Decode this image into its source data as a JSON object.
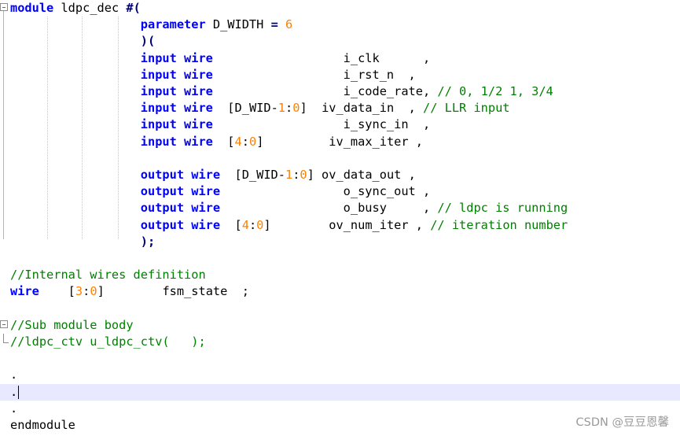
{
  "editor": {
    "lines": [
      [
        [
          "kw",
          "module"
        ],
        [
          "id",
          " ldpc_dec "
        ],
        [
          "op",
          "#("
        ]
      ],
      [
        [
          "id",
          "                  "
        ],
        [
          "kw",
          "parameter"
        ],
        [
          "id",
          " D_WIDTH "
        ],
        [
          "op",
          "="
        ],
        [
          "id",
          " "
        ],
        [
          "num",
          "6"
        ]
      ],
      [
        [
          "id",
          "                  "
        ],
        [
          "op",
          ")("
        ]
      ],
      [
        [
          "id",
          "                  "
        ],
        [
          "kw",
          "input wire"
        ],
        [
          "id",
          "                  i_clk      ,"
        ]
      ],
      [
        [
          "id",
          "                  "
        ],
        [
          "kw",
          "input wire"
        ],
        [
          "id",
          "                  i_rst_n  ,"
        ]
      ],
      [
        [
          "id",
          "                  "
        ],
        [
          "kw",
          "input wire"
        ],
        [
          "id",
          "                  i_code_rate, "
        ],
        [
          "cm",
          "// 0, 1/2 1, 3/4"
        ]
      ],
      [
        [
          "id",
          "                  "
        ],
        [
          "kw",
          "input wire"
        ],
        [
          "id",
          "  [D_WID-"
        ],
        [
          "num",
          "1"
        ],
        [
          "id",
          ":"
        ],
        [
          "num",
          "0"
        ],
        [
          "id",
          "]  iv_data_in  , "
        ],
        [
          "cm",
          "// LLR input"
        ]
      ],
      [
        [
          "id",
          "                  "
        ],
        [
          "kw",
          "input wire"
        ],
        [
          "id",
          "                  i_sync_in  ,"
        ]
      ],
      [
        [
          "id",
          "                  "
        ],
        [
          "kw",
          "input wire"
        ],
        [
          "id",
          "  ["
        ],
        [
          "num",
          "4"
        ],
        [
          "id",
          ":"
        ],
        [
          "num",
          "0"
        ],
        [
          "id",
          "]         iv_max_iter ,"
        ]
      ],
      [],
      [
        [
          "id",
          "                  "
        ],
        [
          "kw",
          "output wire"
        ],
        [
          "id",
          "  [D_WID-"
        ],
        [
          "num",
          "1"
        ],
        [
          "id",
          ":"
        ],
        [
          "num",
          "0"
        ],
        [
          "id",
          "] ov_data_out ,"
        ]
      ],
      [
        [
          "id",
          "                  "
        ],
        [
          "kw",
          "output wire"
        ],
        [
          "id",
          "                 o_sync_out ,"
        ]
      ],
      [
        [
          "id",
          "                  "
        ],
        [
          "kw",
          "output wire"
        ],
        [
          "id",
          "                 o_busy     , "
        ],
        [
          "cm",
          "// ldpc is running"
        ]
      ],
      [
        [
          "id",
          "                  "
        ],
        [
          "kw",
          "output wire"
        ],
        [
          "id",
          "  ["
        ],
        [
          "num",
          "4"
        ],
        [
          "id",
          ":"
        ],
        [
          "num",
          "0"
        ],
        [
          "id",
          "]        ov_num_iter , "
        ],
        [
          "cm",
          "// iteration number"
        ]
      ],
      [
        [
          "id",
          "                  "
        ],
        [
          "op",
          ");"
        ]
      ],
      [],
      [
        [
          "cm",
          "//Internal wires definition"
        ]
      ],
      [
        [
          "kw",
          "wire"
        ],
        [
          "id",
          "    ["
        ],
        [
          "num",
          "3"
        ],
        [
          "id",
          ":"
        ],
        [
          "num",
          "0"
        ],
        [
          "id",
          "]        fsm_state  ;"
        ]
      ],
      [],
      [
        [
          "cm",
          "//Sub module body"
        ]
      ],
      [
        [
          "cm",
          "//ldpc_ctv u_ldpc_ctv(   );"
        ]
      ],
      [],
      [
        [
          "id",
          "."
        ]
      ],
      [
        [
          "id",
          "."
        ]
      ],
      [
        [
          "id",
          "."
        ]
      ],
      [
        [
          "id",
          "endmodule"
        ]
      ]
    ]
  },
  "watermark": "CSDN @豆豆恩馨",
  "colors": {
    "keyword": "#0000ff",
    "number": "#ff8000",
    "comment": "#008000",
    "operator": "#000080",
    "current_line": "#e8e8ff"
  },
  "icons": [
    "fold-collapse-icon",
    "fold-end-icon"
  ]
}
